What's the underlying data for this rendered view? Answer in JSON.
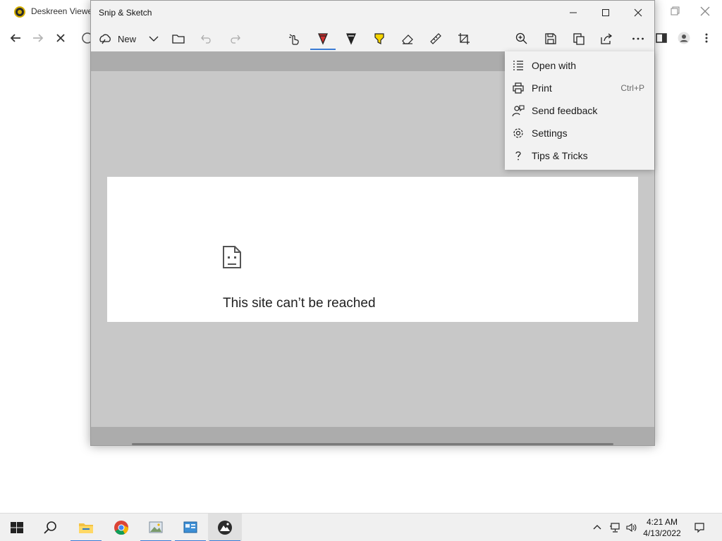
{
  "background_browser": {
    "title": "Deskreen Viewer",
    "colors": {
      "logo_accent": "#d6b000"
    },
    "icons": [
      "back-arrow-icon",
      "forward-arrow-icon",
      "stop-icon",
      "info-icon",
      "reading-mode-icon",
      "profile-icon",
      "more-vert-icon",
      "restore-icon",
      "close-icon"
    ]
  },
  "snip_window": {
    "title": "Snip & Sketch",
    "toolbar": {
      "new_label": "New",
      "tools": [
        "touch-writing-icon",
        "ballpoint-pen-icon",
        "pencil-icon",
        "highlighter-icon",
        "eraser-icon",
        "ruler-icon",
        "crop-icon",
        "zoom-icon",
        "save-icon",
        "copy-icon",
        "share-icon",
        "more-icon"
      ]
    },
    "snip_content": {
      "heading": "This site can’t be reached"
    },
    "colors": {
      "accent": "#3a7bd5",
      "pen_red": "#d32f2f",
      "highlighter_yellow": "#f5d400"
    }
  },
  "overflow_menu": {
    "items": [
      {
        "label": "Open with",
        "icon": "open-with-icon",
        "shortcut": ""
      },
      {
        "label": "Print",
        "icon": "printer-icon",
        "shortcut": "Ctrl+P"
      },
      {
        "label": "Send feedback",
        "icon": "feedback-icon",
        "shortcut": ""
      },
      {
        "label": "Settings",
        "icon": "gear-icon",
        "shortcut": ""
      },
      {
        "label": "Tips & Tricks",
        "icon": "question-icon",
        "shortcut": ""
      }
    ]
  },
  "taskbar": {
    "apps": [
      "start-icon",
      "search-icon",
      "file-explorer-icon",
      "chrome-icon",
      "photo-viewer-icon",
      "control-panel-icon",
      "snip-sketch-icon"
    ],
    "clock": {
      "time": "4:21 AM",
      "date": "4/13/2022"
    }
  }
}
